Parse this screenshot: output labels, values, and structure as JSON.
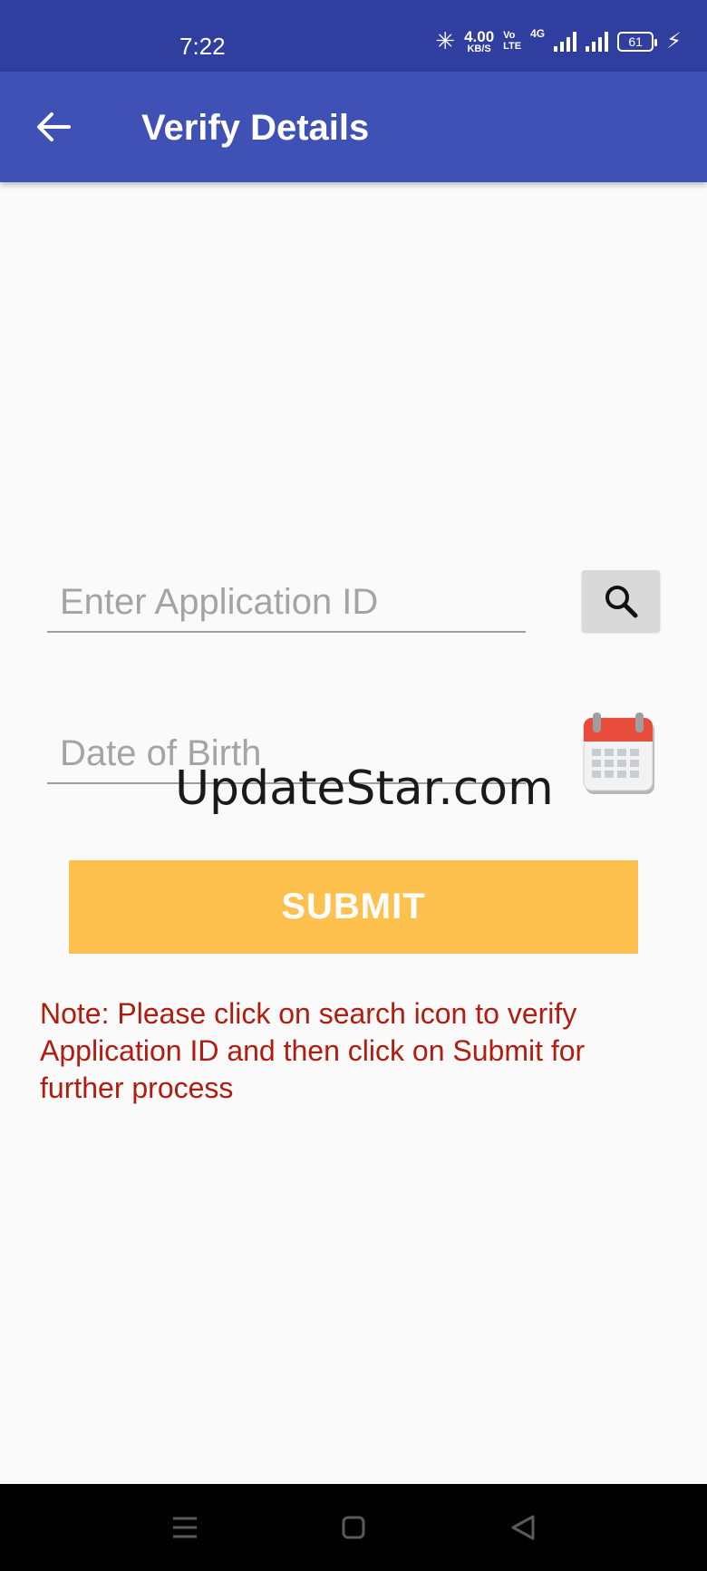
{
  "status_bar": {
    "time": "7:22",
    "net_speed_value": "4.00",
    "net_speed_unit": "KB/S",
    "volte_top": "Vo",
    "volte_bottom": "LTE",
    "signal_label": "4G",
    "battery_level": "61"
  },
  "app_bar": {
    "title": "Verify Details",
    "back_icon": "arrow-back-icon"
  },
  "form": {
    "application_id_placeholder": "Enter Application ID",
    "application_id_value": "",
    "search_icon": "search-icon",
    "dob_placeholder": "Date of Birth",
    "dob_value": "",
    "calendar_icon": "calendar-icon",
    "submit_label": "SUBMIT"
  },
  "note": "Note: Please click on search icon to verify Application ID and then click on Submit for further process",
  "watermark": "UpdateStar.com",
  "colors": {
    "status_bar": "#303f9f",
    "app_bar": "#3f51b5",
    "submit_button": "#ffc14d",
    "note_text": "#b21c0e",
    "search_button": "#d9d9d9"
  },
  "nav_bar": {
    "menu_icon": "menu-icon",
    "home_icon": "home-square-icon",
    "back_icon": "back-triangle-icon"
  }
}
